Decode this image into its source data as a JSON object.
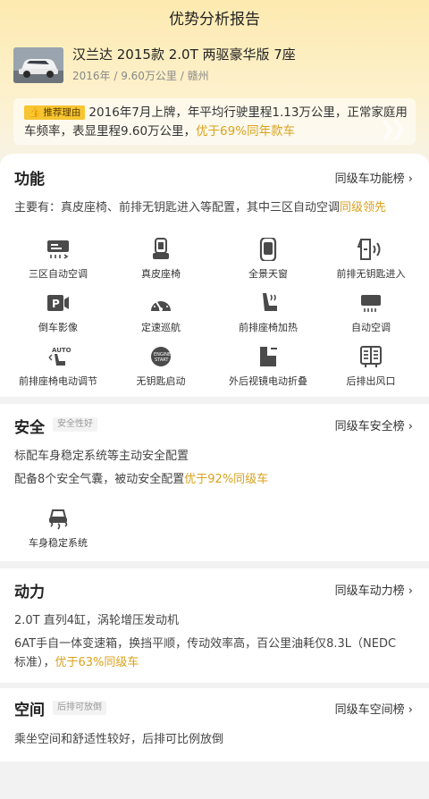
{
  "header": {
    "title": "优势分析报告"
  },
  "car": {
    "name": "汉兰达 2015款 2.0T 两驱豪华版 7座",
    "meta": "2016年 / 9.60万公里 / 赣州"
  },
  "reason": {
    "tag": "推荐理由",
    "text": "2016年7月上牌，年平均行驶里程1.13万公里，正常家庭用车频率，表显里程9.60万公里，",
    "highlight": "优于69%同年款车"
  },
  "features": {
    "title": "功能",
    "link": "同级车功能榜 ›",
    "summary": "主要有：真皮座椅、前排无钥匙进入等配置，其中三区自动空调",
    "summary_highlight": "同级领先",
    "items": [
      {
        "label": "三区自动空调",
        "icon": "ac-icon"
      },
      {
        "label": "真皮座椅",
        "icon": "seat-icon"
      },
      {
        "label": "全景天窗",
        "icon": "sunroof-icon"
      },
      {
        "label": "前排无钥匙进入",
        "icon": "keyless-entry-icon"
      },
      {
        "label": "倒车影像",
        "icon": "reverse-camera-icon"
      },
      {
        "label": "定速巡航",
        "icon": "cruise-icon"
      },
      {
        "label": "前排座椅加热",
        "icon": "seat-heat-icon"
      },
      {
        "label": "自动空调",
        "icon": "auto-ac-icon"
      },
      {
        "label": "前排座椅电动调节",
        "icon": "seat-adjust-icon"
      },
      {
        "label": "无钥匙启动",
        "icon": "start-stop-icon"
      },
      {
        "label": "外后视镜电动折叠",
        "icon": "mirror-fold-icon"
      },
      {
        "label": "后排出风口",
        "icon": "rear-vent-icon"
      }
    ]
  },
  "safety": {
    "title": "安全",
    "badge": "安全性好",
    "link": "同级车安全榜 ›",
    "line1": "标配车身稳定系统等主动安全配置",
    "line2": "配备8个安全气囊，被动安全配置",
    "line2_highlight": "优于92%同级车",
    "items": [
      {
        "label": "车身稳定系统",
        "icon": "esp-icon"
      }
    ]
  },
  "power": {
    "title": "动力",
    "link": "同级车动力榜 ›",
    "line1": "2.0T 直列4缸，涡轮增压发动机",
    "line2": "6AT手自一体变速箱，换挡平顺，传动效率高，百公里油耗仅8.3L（NEDC",
    "line3": "标准），",
    "line3_highlight": "优于63%同级车"
  },
  "space": {
    "title": "空间",
    "badge": "后排可放倒",
    "link": "同级车空间榜 ›",
    "line1": "乘坐空间和舒适性较好，后排可比例放倒"
  },
  "colors": {
    "accent": "#d9a21c",
    "tag": "#f7c531"
  }
}
